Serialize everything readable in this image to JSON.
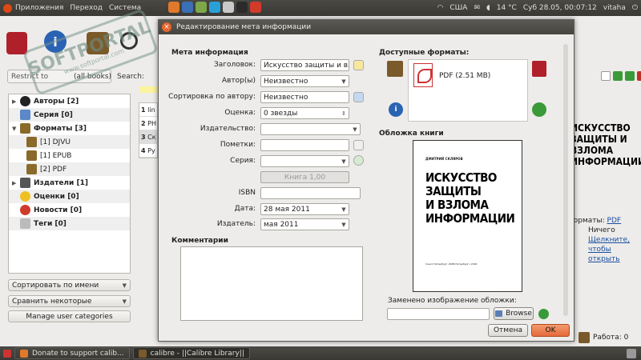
{
  "top_panel": {
    "menu": [
      "Приложения",
      "Переход",
      "Система"
    ],
    "keyboard": "США",
    "temperature": "14 °C",
    "datetime": "Суб 28.05, 00:07:12",
    "user": "vitaha"
  },
  "bottom_panel": {
    "tasks": [
      {
        "label": "Donate to support calib..."
      },
      {
        "label": "calibre - ||Calibre Library||"
      }
    ]
  },
  "calibre": {
    "restrict_label": "Restrict to",
    "all_books": "(all books)",
    "search_label": "Search:",
    "tag_browser": [
      {
        "label": "Авторы [2]",
        "level": 0,
        "expanded": false
      },
      {
        "label": "Серия [0]",
        "level": 0,
        "expanded": false
      },
      {
        "label": "Форматы [3]",
        "level": 0,
        "expanded": true
      },
      {
        "label": "[1] DJVU",
        "level": 1
      },
      {
        "label": "[1] EPUB",
        "level": 1
      },
      {
        "label": "[2] PDF",
        "level": 1
      },
      {
        "label": "Издатели [1]",
        "level": 0,
        "expanded": false
      },
      {
        "label": "Оценки [0]",
        "level": 0
      },
      {
        "label": "Новости [0]",
        "level": 0
      },
      {
        "label": "Теги [0]",
        "level": 0
      }
    ],
    "sort_button": "Сортировать по имени",
    "match_button": "Сравнить некоторые",
    "manage_button": "Manage user categories",
    "list_rows": [
      {
        "num": "1",
        "text": "lin"
      },
      {
        "num": "2",
        "text": "PH"
      },
      {
        "num": "3",
        "text": "Ск"
      },
      {
        "num": "4",
        "text": "Ру"
      }
    ],
    "right_cover_text": "ИСКУССТВО ЗАЩИТЫ И ВЗЛОМА ИНФОРМАЦИИ",
    "right_info": {
      "formats_label": "Форматы:",
      "formats_value": "PDF",
      "nothing": "Ничего",
      "click_link": "Щелкните, чтобы открыть"
    },
    "jobs": "Работа: 0"
  },
  "watermark": {
    "big": "SOFTPORTAL",
    "small": "www.softportal.com"
  },
  "dialog": {
    "title": "Редактирование мета информации",
    "meta_section": "Мета информация",
    "fields": {
      "title": {
        "label": "Заголовок:",
        "value": "Искусство защиты и взлома"
      },
      "author": {
        "label": "Автор(ы)",
        "value": "Неизвестно"
      },
      "author_sort": {
        "label": "Сортировка по автору:",
        "value": "Неизвестно"
      },
      "rating": {
        "label": "Оценка:",
        "value": "0 звезды"
      },
      "publisher": {
        "label": "Издательство:",
        "value": ""
      },
      "tags": {
        "label": "Пометки:",
        "value": ""
      },
      "series": {
        "label": "Серия:",
        "value": ""
      },
      "series_index": {
        "label": "",
        "value": "Книга 1,00"
      },
      "isbn": {
        "label": "ISBN",
        "value": ""
      },
      "date": {
        "label": "Дата:",
        "value": "28 мая 2011"
      },
      "pubdate": {
        "label": "Издатель:",
        "value": "мая 2011"
      }
    },
    "comments_section": "Комментарии",
    "formats_section": "Доступные форматы:",
    "format_item": "PDF (2.51 MB)",
    "cover_section": "Обложка книги",
    "cover": {
      "author": "ДМИТРИЙ СКЛЯРОВ",
      "title_lines": [
        "ИСКУССТВО",
        "ЗАЩИТЫ",
        "И ВЗЛОМА",
        "ИНФОРМАЦИИ"
      ],
      "publisher": "Санкт-Петербург «БХВ-Петербург» 2004"
    },
    "cover_replace_label": "Заменено изображение обложки:",
    "browse_button": "Browse",
    "cancel_button": "Отмена",
    "ok_button": "OK"
  }
}
